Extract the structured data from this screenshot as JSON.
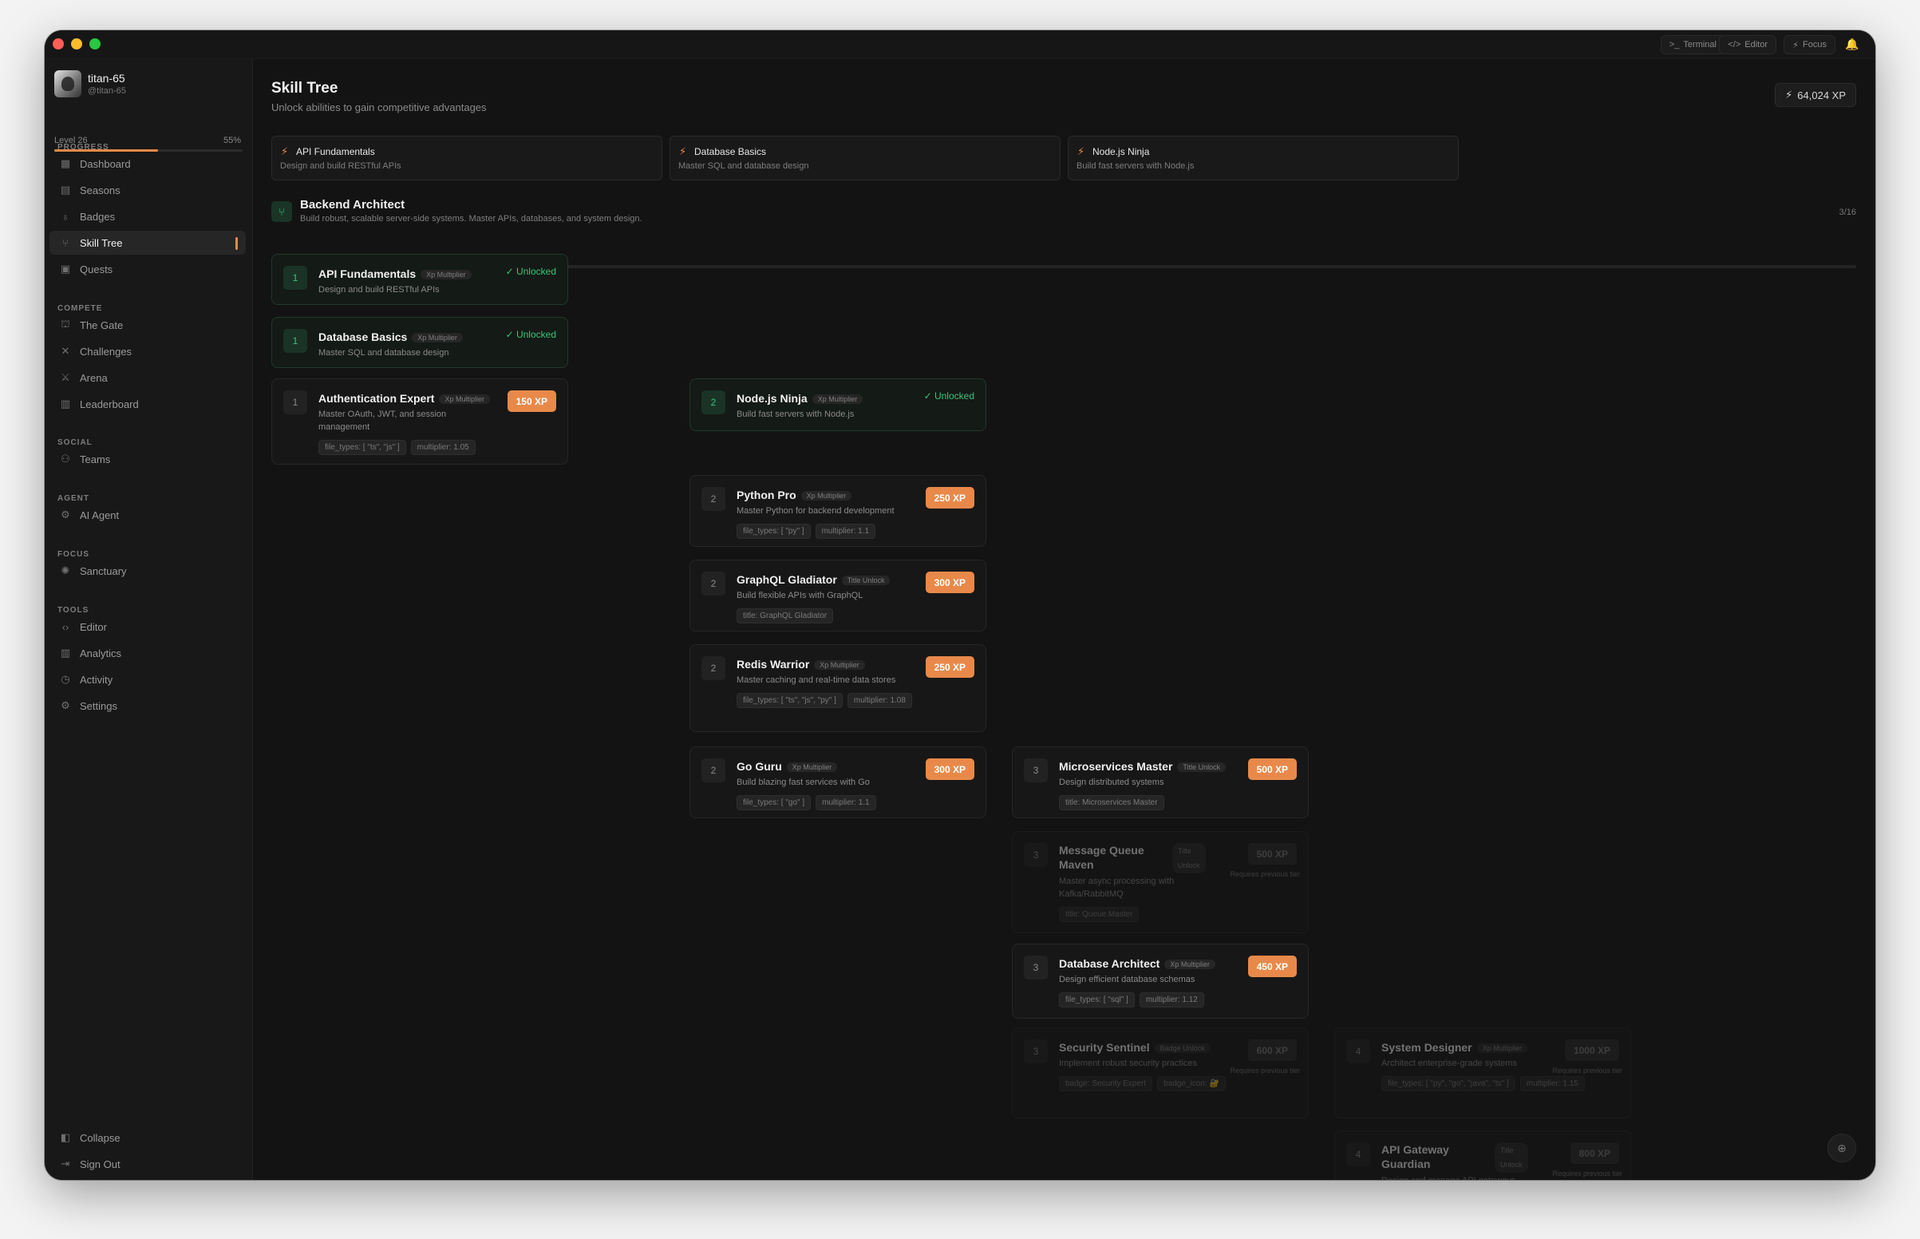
{
  "window": {
    "buttons": [
      {
        "label": "Terminal",
        "icon": ">_"
      },
      {
        "label": "Editor",
        "icon": "</>"
      },
      {
        "label": "Focus",
        "icon": "⚡"
      }
    ]
  },
  "user": {
    "name": "titan-65",
    "handle": "@titan-65",
    "level_label": "Level 26",
    "progress_percent": "55%",
    "progress_fraction": 0.55
  },
  "sidebar": {
    "sections": [
      {
        "title": "PROGRESS",
        "items": [
          "Dashboard",
          "Seasons",
          "Badges",
          "Skill Tree",
          "Quests"
        ]
      },
      {
        "title": "COMPETE",
        "items": [
          "The Gate",
          "Challenges",
          "Arena",
          "Leaderboard"
        ]
      },
      {
        "title": "SOCIAL",
        "items": [
          "Teams"
        ]
      },
      {
        "title": "AGENT",
        "items": [
          "AI Agent"
        ]
      },
      {
        "title": "FOCUS",
        "items": [
          "Sanctuary"
        ]
      },
      {
        "title": "TOOLS",
        "items": [
          "Editor",
          "Analytics",
          "Activity",
          "Settings"
        ]
      }
    ],
    "active": "Skill Tree",
    "footer": [
      "Collapse",
      "Sign Out"
    ]
  },
  "page": {
    "title": "Skill Tree",
    "subtitle": "Unlock abilities to gain competitive advantages",
    "xp_total": "64,024 XP"
  },
  "pinned": [
    {
      "title": "API Fundamentals",
      "desc": "Design and build RESTful APIs"
    },
    {
      "title": "Database Basics",
      "desc": "Master SQL and database design"
    },
    {
      "title": "Node.js Ninja",
      "desc": "Build fast servers with Node.js"
    }
  ],
  "track": {
    "title": "Backend Architect",
    "desc": "Build robust, scalable server-side systems. Master APIs, databases, and system design.",
    "count": "3/16",
    "progress_fraction": 0.1875
  },
  "skills": [
    {
      "tier": "1",
      "name": "API Fundamentals",
      "type": "Xp Multiplier",
      "desc": "Design and build RESTful APIs",
      "status": "Unlocked",
      "cost": "",
      "tags": []
    },
    {
      "tier": "1",
      "name": "Database Basics",
      "type": "Xp Multiplier",
      "desc": "Master SQL and database design",
      "status": "Unlocked",
      "cost": "",
      "tags": []
    },
    {
      "tier": "1",
      "name": "Authentication Expert",
      "type": "Xp Multiplier",
      "desc": "Master OAuth, JWT, and session management",
      "status": "",
      "cost": "150 XP",
      "tags": [
        "file_types: [ \"ts\", \"js\" ]",
        "multiplier: 1.05"
      ]
    },
    {
      "tier": "2",
      "name": "Node.js Ninja",
      "type": "Xp Multiplier",
      "desc": "Build fast servers with Node.js",
      "status": "Unlocked",
      "cost": "",
      "tags": []
    },
    {
      "tier": "2",
      "name": "Python Pro",
      "type": "Xp Multiplier",
      "desc": "Master Python for backend development",
      "status": "",
      "cost": "250 XP",
      "tags": [
        "file_types: [ \"py\" ]",
        "multiplier: 1.1"
      ]
    },
    {
      "tier": "2",
      "name": "GraphQL Gladiator",
      "type": "Title Unlock",
      "desc": "Build flexible APIs with GraphQL",
      "status": "",
      "cost": "300 XP",
      "tags": [
        "title: GraphQL Gladiator"
      ]
    },
    {
      "tier": "2",
      "name": "Redis Warrior",
      "type": "Xp Multiplier",
      "desc": "Master caching and real-time data stores",
      "status": "",
      "cost": "250 XP",
      "tags": [
        "file_types: [ \"ts\", \"js\", \"py\" ]",
        "multiplier: 1.08"
      ]
    },
    {
      "tier": "2",
      "name": "Go Guru",
      "type": "Xp Multiplier",
      "desc": "Build blazing fast services with Go",
      "status": "",
      "cost": "300 XP",
      "tags": [
        "file_types: [ \"go\" ]",
        "multiplier: 1.1"
      ]
    },
    {
      "tier": "3",
      "name": "Microservices Master",
      "type": "Title Unlock",
      "desc": "Design distributed systems",
      "status": "",
      "cost": "500 XP",
      "tags": [
        "title: Microservices Master"
      ]
    },
    {
      "tier": "3",
      "name": "Message Queue Maven",
      "type": "Title Unlock",
      "desc": "Master async processing with Kafka/RabbitMQ",
      "status": "locked",
      "cost": "500 XP",
      "req": "Requires previous tier",
      "tags": [
        "title: Queue Master"
      ]
    },
    {
      "tier": "3",
      "name": "Database Architect",
      "type": "Xp Multiplier",
      "desc": "Design efficient database schemas",
      "status": "",
      "cost": "450 XP",
      "tags": [
        "file_types: [ \"sql\" ]",
        "multiplier: 1.12"
      ]
    },
    {
      "tier": "3",
      "name": "Security Sentinel",
      "type": "Badge Unlock",
      "desc": "Implement robust security practices",
      "status": "locked",
      "cost": "600 XP",
      "req": "Requires previous tier",
      "tags": [
        "badge: Security Expert",
        "badge_icon: 🔐"
      ]
    },
    {
      "tier": "4",
      "name": "System Designer",
      "type": "Xp Multiplier",
      "desc": "Architect enterprise-grade systems",
      "status": "locked",
      "cost": "1000 XP",
      "req": "Requires previous tier",
      "tags": [
        "file_types: [ \"py\", \"go\", \"java\", \"ts\" ]",
        "multiplier: 1.15"
      ]
    },
    {
      "tier": "4",
      "name": "API Gateway Guardian",
      "type": "Title Unlock",
      "desc": "Design and manage API gateways",
      "status": "locked",
      "cost": "800 XP",
      "req": "Requires previous tier",
      "tags": []
    }
  ],
  "colors": {
    "accent": "#e8894a",
    "success": "#3bc47a",
    "bg": "#131313"
  }
}
